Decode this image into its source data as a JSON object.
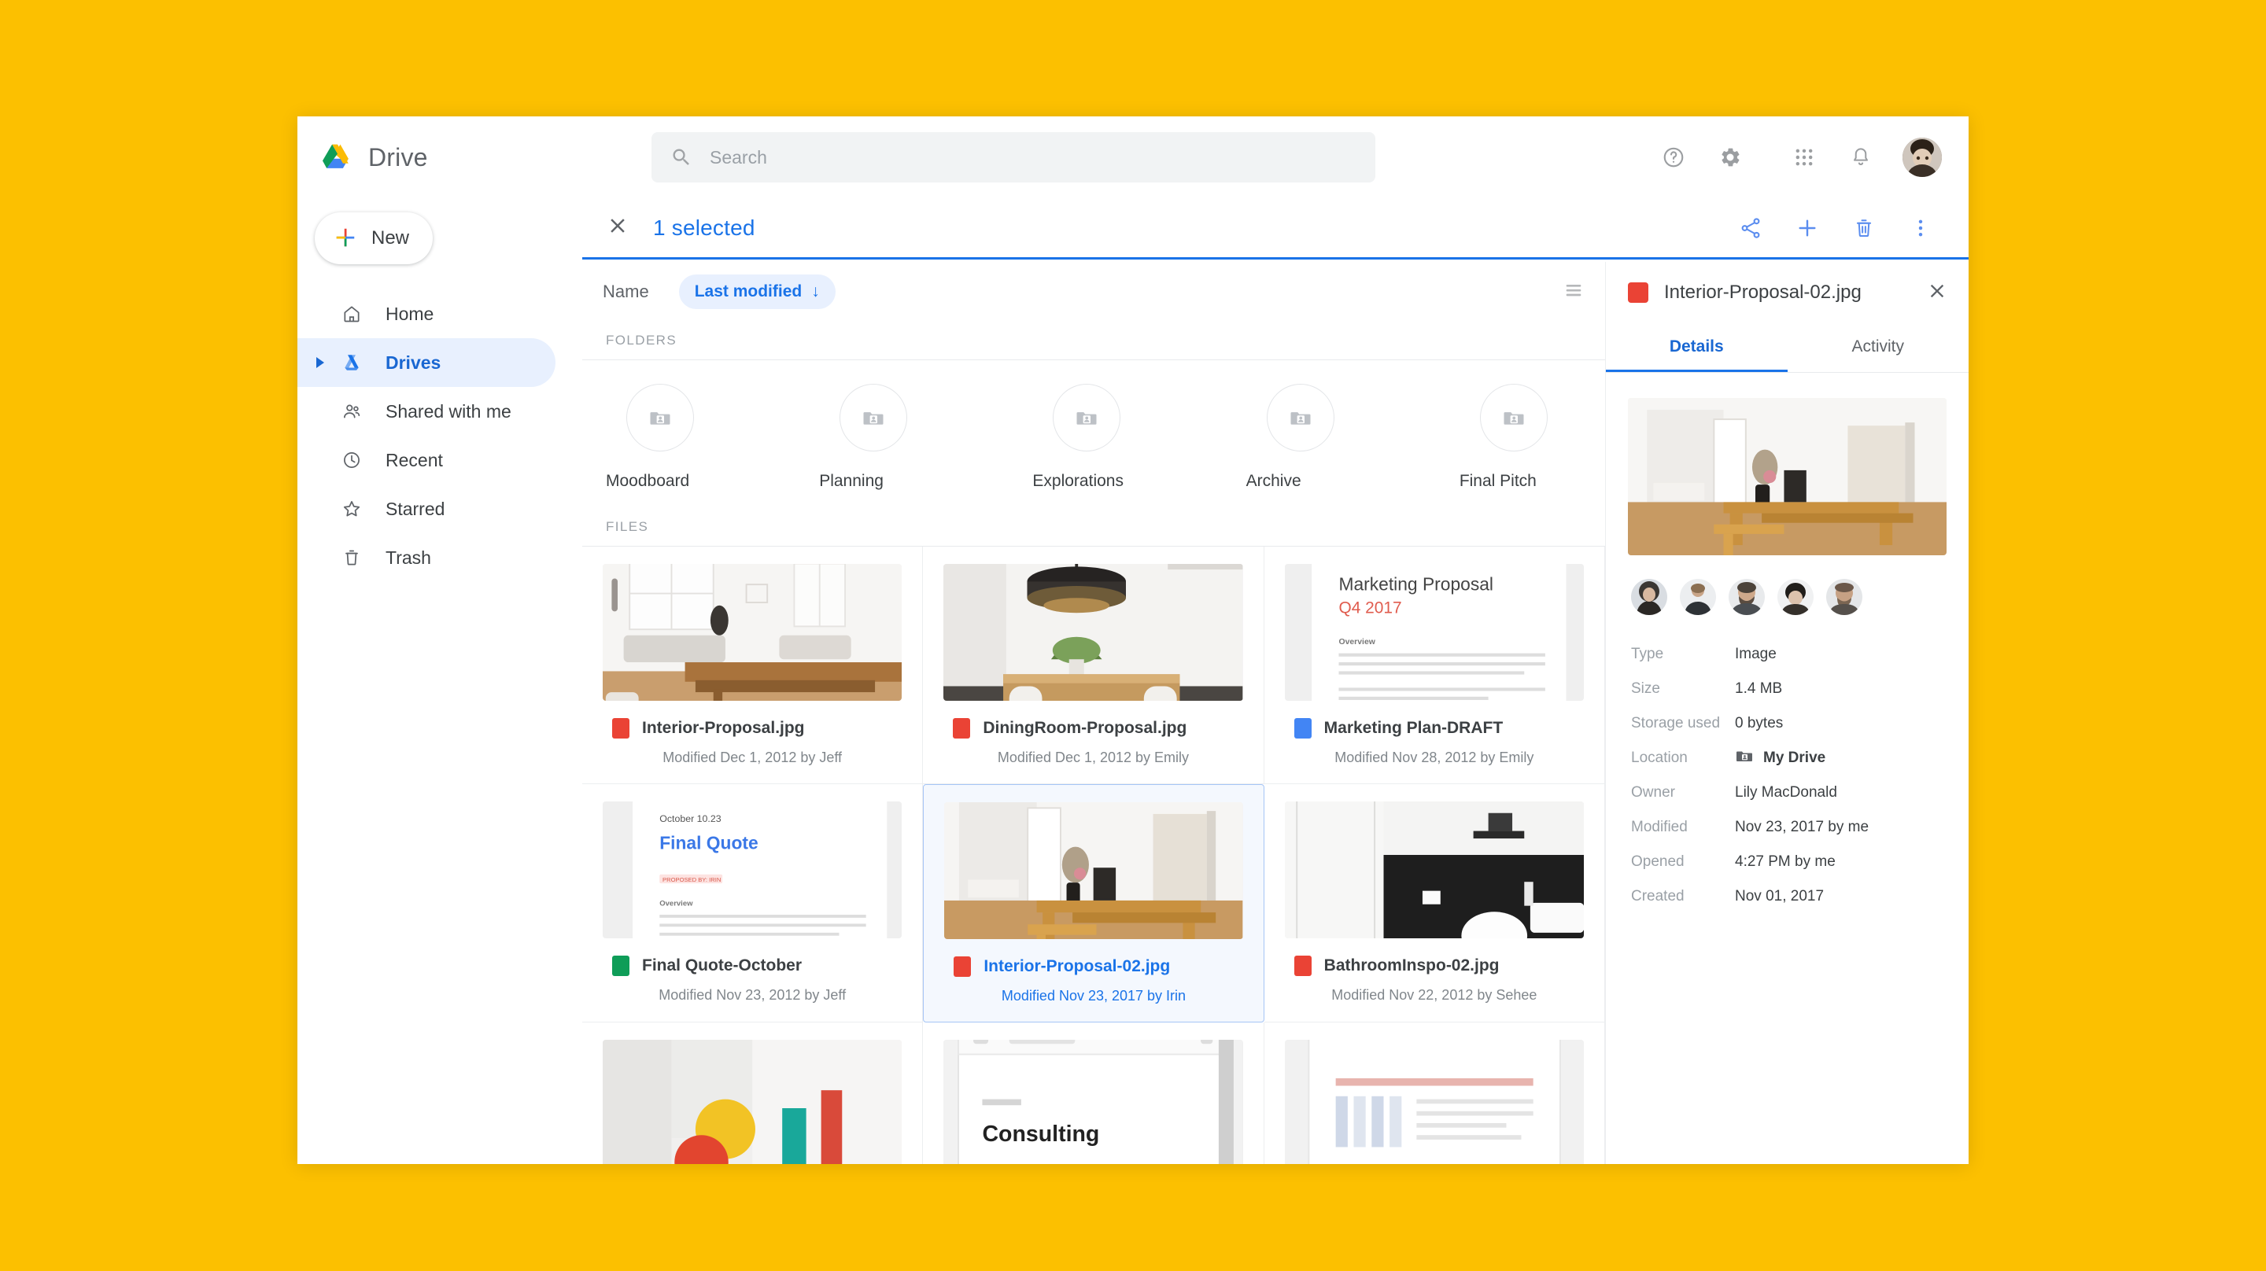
{
  "app": {
    "brand_name": "Drive",
    "logo_icon": "google-drive-logo"
  },
  "search": {
    "placeholder": "Search",
    "value": "",
    "icon": "search-icon"
  },
  "topbar_icons": [
    {
      "name": "help-icon",
      "label": "Help"
    },
    {
      "name": "settings-gear-icon",
      "label": "Settings"
    },
    {
      "name": "apps-grid-icon",
      "label": "Google apps"
    },
    {
      "name": "notifications-bell-icon",
      "label": "Notifications"
    },
    {
      "name": "account-avatar",
      "label": "Account"
    }
  ],
  "selection_bar": {
    "close_icon": "close-x-icon",
    "count_text": "1 selected",
    "actions": [
      {
        "name": "share-icon",
        "label": "Share"
      },
      {
        "name": "add-to-icon",
        "label": "Add"
      },
      {
        "name": "trash-icon",
        "label": "Remove"
      },
      {
        "name": "more-vertical-icon",
        "label": "More actions"
      }
    ]
  },
  "sidebar": {
    "new_button": {
      "label": "New",
      "icon": "plus-icon"
    },
    "items": [
      {
        "label": "Home",
        "icon": "home-icon",
        "active": false
      },
      {
        "label": "Drives",
        "icon": "drive-triangle-icon",
        "active": true
      },
      {
        "label": "Shared with me",
        "icon": "people-icon",
        "active": false
      },
      {
        "label": "Recent",
        "icon": "clock-icon",
        "active": false
      },
      {
        "label": "Starred",
        "icon": "star-icon",
        "active": false
      },
      {
        "label": "Trash",
        "icon": "trash-icon",
        "active": false
      }
    ]
  },
  "toolbar": {
    "name_label": "Name",
    "sort_chip_label": "Last modified",
    "sort_chip_arrow": "↓",
    "view_toggle_icon": "list-view-icon"
  },
  "sections": {
    "folders_label": "FOLDERS",
    "files_label": "FILES"
  },
  "folders": [
    {
      "name": "Moodboard",
      "icon": "shared-folder-icon"
    },
    {
      "name": "Planning",
      "icon": "shared-folder-icon"
    },
    {
      "name": "Explorations",
      "icon": "shared-folder-icon"
    },
    {
      "name": "Archive",
      "icon": "shared-folder-icon"
    },
    {
      "name": "Final Pitch",
      "icon": "shared-folder-icon"
    }
  ],
  "files": [
    {
      "name": "Interior-Proposal.jpg",
      "meta": "Modified Dec 1, 2012 by Jeff",
      "type_icon": "image-file-icon",
      "type_color": "#EA4335",
      "thumb": "living-room-photo",
      "selected": false
    },
    {
      "name": "DiningRoom-Proposal.jpg",
      "meta": "Modified Dec 1, 2012 by Emily",
      "type_icon": "image-file-icon",
      "type_color": "#EA4335",
      "thumb": "dining-room-photo",
      "selected": false
    },
    {
      "name": "Marketing Plan-DRAFT",
      "meta": "Modified Nov 28, 2012 by Emily",
      "type_icon": "docs-file-icon",
      "type_color": "#4285F4",
      "thumb": "doc-marketing-proposal",
      "thumb_text": {
        "title": "Marketing Proposal",
        "subtitle": "Q4 2017",
        "heading": "Overview"
      },
      "selected": false
    },
    {
      "name": "Final Quote-October",
      "meta": "Modified Nov 23, 2012 by Jeff",
      "type_icon": "sheets-file-icon",
      "type_color": "#0F9D58",
      "thumb": "doc-final-quote",
      "thumb_text": {
        "date": "October 10.23",
        "title": "Final Quote",
        "heading": "Overview"
      },
      "selected": false
    },
    {
      "name": "Interior-Proposal-02.jpg",
      "meta": "Modified Nov 23, 2017 by Irin",
      "type_icon": "image-file-icon",
      "type_color": "#EA4335",
      "thumb": "interior-room-photo",
      "selected": true
    },
    {
      "name": "BathroomInspo-02.jpg",
      "meta": "Modified Nov 22, 2012 by Sehee",
      "type_icon": "image-file-icon",
      "type_color": "#EA4335",
      "thumb": "bathroom-photo",
      "selected": false
    },
    {
      "name": "",
      "meta": "",
      "type_icon": "image-file-icon",
      "type_color": "#EA4335",
      "thumb": "colorful-room-photo",
      "selected": false
    },
    {
      "name": "",
      "meta": "",
      "type_icon": "docs-file-icon",
      "type_color": "#4285F4",
      "thumb": "doc-consulting",
      "thumb_text": {
        "title": "Consulting"
      },
      "selected": false
    },
    {
      "name": "",
      "meta": "",
      "type_icon": "sheets-file-icon",
      "type_color": "#0F9D58",
      "thumb": "doc-spreadsheet",
      "selected": false
    }
  ],
  "details_panel": {
    "title": "Interior-Proposal-02.jpg",
    "title_icon": "image-file-icon",
    "close_icon": "close-x-icon",
    "tabs": [
      {
        "label": "Details",
        "active": true
      },
      {
        "label": "Activity",
        "active": false
      }
    ],
    "preview_thumb": "interior-room-photo",
    "collaborators_count": 5,
    "metadata": [
      {
        "key": "Type",
        "value": "Image",
        "bold": false
      },
      {
        "key": "Size",
        "value": "1.4 MB",
        "bold": false
      },
      {
        "key": "Storage used",
        "value": "0 bytes",
        "bold": false
      },
      {
        "key": "Location",
        "value": "My Drive",
        "bold": true,
        "icon": "shared-folder-icon"
      },
      {
        "key": "Owner",
        "value": "Lily MacDonald",
        "bold": false
      },
      {
        "key": "Modified",
        "value": "Nov 23, 2017 by me",
        "bold": false
      },
      {
        "key": "Opened",
        "value": "4:27 PM by me",
        "bold": false
      },
      {
        "key": "Created",
        "value": "Nov 01, 2017",
        "bold": false
      }
    ]
  },
  "colors": {
    "page_background": "#FCC000",
    "accent_blue": "#1a73e8",
    "accent_blue_light": "#e8f0fe",
    "text_primary": "#3c4043",
    "text_secondary": "#5f6368",
    "text_muted": "#9aa0a6"
  }
}
